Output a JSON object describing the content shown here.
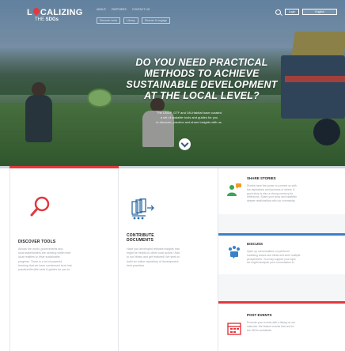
{
  "header": {
    "logo": {
      "line1_a": "L",
      "line1_b": "CALIZING",
      "line2_a": "THE ",
      "line2_b": "SDGs"
    },
    "nav": [
      "About",
      "Partners",
      "Contact us",
      "",
      ""
    ],
    "subnav": [
      "Discover tools",
      "Library",
      "Discuss & engage"
    ],
    "login_label": "Login",
    "language_label": "English"
  },
  "hero": {
    "headline_lines": [
      "DO YOU NEED PRACTICAL",
      "METHODS TO ACHIEVE",
      "SUSTAINABLE DEVELOPMENT",
      "AT THE LOCAL LEVEL?"
    ],
    "tagline_lines": [
      "The UNDP, GTF and UN-Habitat have curated",
      "a set of scalable tools and guides for you",
      "to discover, practice and share insights with us."
    ]
  },
  "cards": {
    "discover": {
      "title": "DISCOVER TOOLS",
      "text_lines": [
        "Across the world, governments and",
        "local stakeholders are working within their",
        "local realities to drive sustainable",
        "progress. There is a lot of powerful",
        "learning that we have condensed here into",
        "practical flexible tools & guides for you to"
      ]
    },
    "contribute": {
      "title_lines": [
        "CONTRIBUTE",
        "DOCUMENTS"
      ],
      "text_lines": [
        "Have you developed relevant insights that",
        "might be helpful to other local actors? Add",
        "to our library and get featured! We seek to",
        "build an online repository of development",
        "best practices."
      ]
    },
    "share": {
      "title": "SHARE STORIES",
      "text_lines": [
        "Stories have the power to connect us with",
        "the aspirations and journeys of others. A",
        "good story is also a strong currency for",
        "reflections. Share your story and establish",
        "deeper relationships with our community."
      ]
    },
    "discuss": {
      "title": "DISCUSS",
      "text_lines": [
        "Open up conversations on pertinent",
        "localizing issues and ideas and seek multiple",
        "perspectives. You may support your topic",
        "we might handpick your conversation to"
      ]
    },
    "post": {
      "title": "POST EVENTS",
      "text_lines": [
        "Promote your events with a listing on our",
        "calendar. We feature events that are for",
        "the SDGs worldwide."
      ]
    }
  },
  "colors": {
    "accent_red": "#e2383f",
    "accent_blue": "#3a82c4",
    "sdg_green": "#3aa657",
    "sdg_orange": "#f39a2b"
  }
}
